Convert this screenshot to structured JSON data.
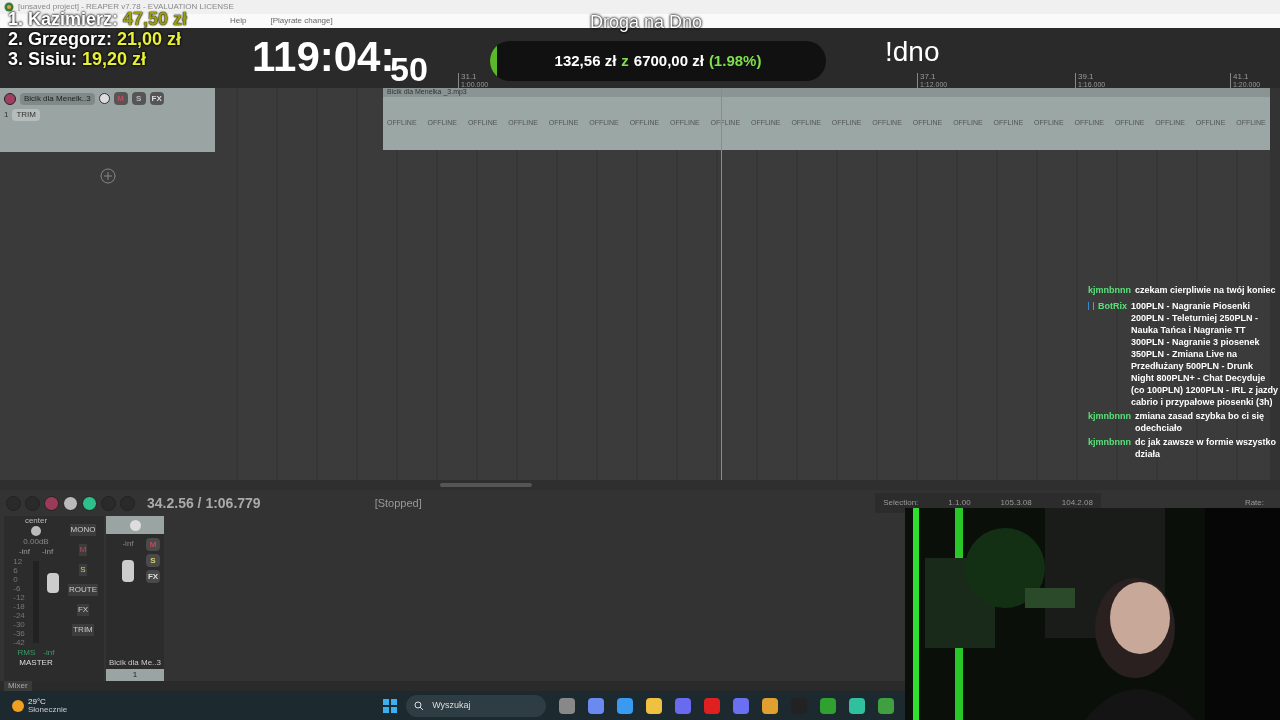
{
  "window": {
    "title": "[unsaved project] - REAPER v7.78 - EVALUATION LICENSE"
  },
  "menu": [
    "Help",
    "[Playrate change]"
  ],
  "overlay": {
    "leaderboard": [
      {
        "rank": "1.",
        "name": "Kazimierz:",
        "amount": "47,50 zł"
      },
      {
        "rank": "2.",
        "name": "Grzegorz:",
        "amount": "21,00 zł"
      },
      {
        "rank": "3.",
        "name": "Sisiu:",
        "amount": "19,20 zł"
      }
    ],
    "stream_title": "Droga na Dno",
    "timer": "119:04:",
    "timer_seconds": "50",
    "command": "!dno",
    "goal": {
      "current": "132,56 zł",
      "of": "z",
      "target": "6700,00 zł",
      "percent": "(1.98%)",
      "level": 0.0198
    }
  },
  "ruler": [
    {
      "bar": "31.1",
      "time": "1:00.000"
    },
    {
      "bar": "37.1",
      "time": "1:12.000"
    },
    {
      "bar": "39.1",
      "time": "1:16.000"
    },
    {
      "bar": "41.1",
      "time": "1:20.000"
    }
  ],
  "track": {
    "name": "Bicik dla Menelk..3",
    "number": "1",
    "trim": "TRIM",
    "mute": "M",
    "solo": "S",
    "fx": "FX"
  },
  "item": {
    "name": "Bicik dla Menelka _3.mp3",
    "labels": [
      "OFFLINE",
      "OFFLINE",
      "OFFLINE",
      "OFFLINE",
      "OFFLINE",
      "OFFLINE",
      "OFFLINE",
      "OFFLINE",
      "OFFLINE",
      "OFFLINE",
      "OFFLINE",
      "OFFLINE",
      "OFFLINE",
      "OFFLINE",
      "OFFLINE",
      "OFFLINE",
      "OFFLINE",
      "OFFLINE",
      "OFFLINE",
      "OFFLINE",
      "OFFLINE",
      "OFFLINE"
    ]
  },
  "transport": {
    "position": "34.2.56 / 1:06.779",
    "status": "[Stopped]"
  },
  "selection": {
    "label": "Selection:",
    "values": [
      "1.1.00",
      "105.3.08",
      "104.2.08"
    ],
    "rate": "Rate:"
  },
  "mixer": {
    "master": {
      "pan": "center",
      "volume": "0.00dB",
      "peaks": [
        "-inf",
        "-inf"
      ],
      "scale": [
        "12",
        "6",
        "0",
        "-6",
        "-12",
        "-18",
        "-24",
        "-30",
        "-36",
        "-42"
      ],
      "rms": "RMS",
      "rms_value": "-inf",
      "name": "MASTER",
      "buttons": [
        "MONO",
        "M",
        "S",
        "ROUTE",
        "FX",
        "TRIM"
      ]
    },
    "strip": {
      "peak": "-inf",
      "buttons": [
        "M",
        "S",
        "FX"
      ],
      "name": "Bicik dla Me..3",
      "number": "1"
    },
    "tab": "Mixer"
  },
  "chat": [
    {
      "user": "kjmnbnnn",
      "text": "czekam cierpliwie na twój koniec",
      "badges": false
    },
    {
      "user": "BotRix",
      "text": "100PLN - Nagranie Piosenki 200PLN - Teleturniej 250PLN - Nauka Tańca i Nagranie TT 300PLN - Nagranie 3 piosenek 350PLN - Zmiana Live na Przedłużany 500PLN - Drunk Night 800PLN+ - Chat Decyduje (co 100PLN) 1200PLN - IRL z jazdy cabrio i przypałowe piosenki (3h)",
      "badges": true
    },
    {
      "user": "kjmnbnnn",
      "text": "zmiana zasad szybka bo ci się odechciało",
      "badges": false
    },
    {
      "user": "kjmnbnnn",
      "text": "dc jak zawsze w formie wszystko działa",
      "badges": false
    }
  ],
  "taskbar": {
    "temperature": "29°C",
    "weather": "Słonecznie",
    "search": "Wyszukaj"
  }
}
